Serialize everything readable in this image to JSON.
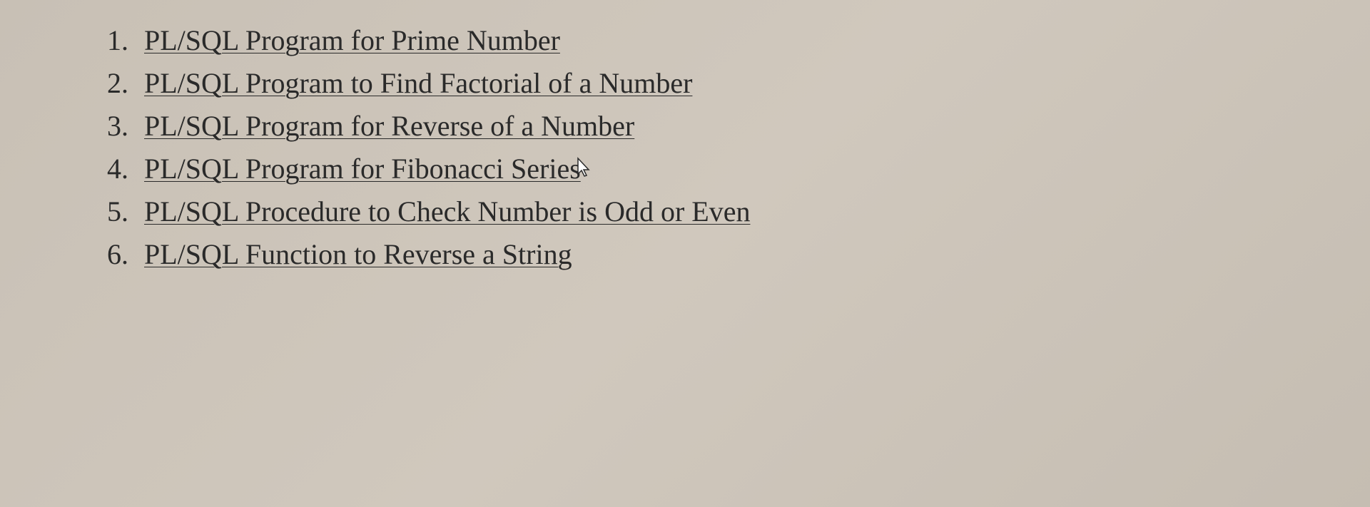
{
  "list": {
    "items": [
      {
        "number": "1.",
        "text": "PL/SQL Program for Prime Number"
      },
      {
        "number": "2.",
        "text": "PL/SQL Program to Find Factorial of a Number"
      },
      {
        "number": "3.",
        "text": "PL/SQL Program for Reverse of a Number"
      },
      {
        "number": "4.",
        "text": "PL/SQL Program for Fibonacci Series"
      },
      {
        "number": "5.",
        "text": "PL/SQL Procedure to Check Number is Odd or Even"
      },
      {
        "number": "6.",
        "text": "PL/SQL Function to Reverse a String"
      }
    ]
  }
}
